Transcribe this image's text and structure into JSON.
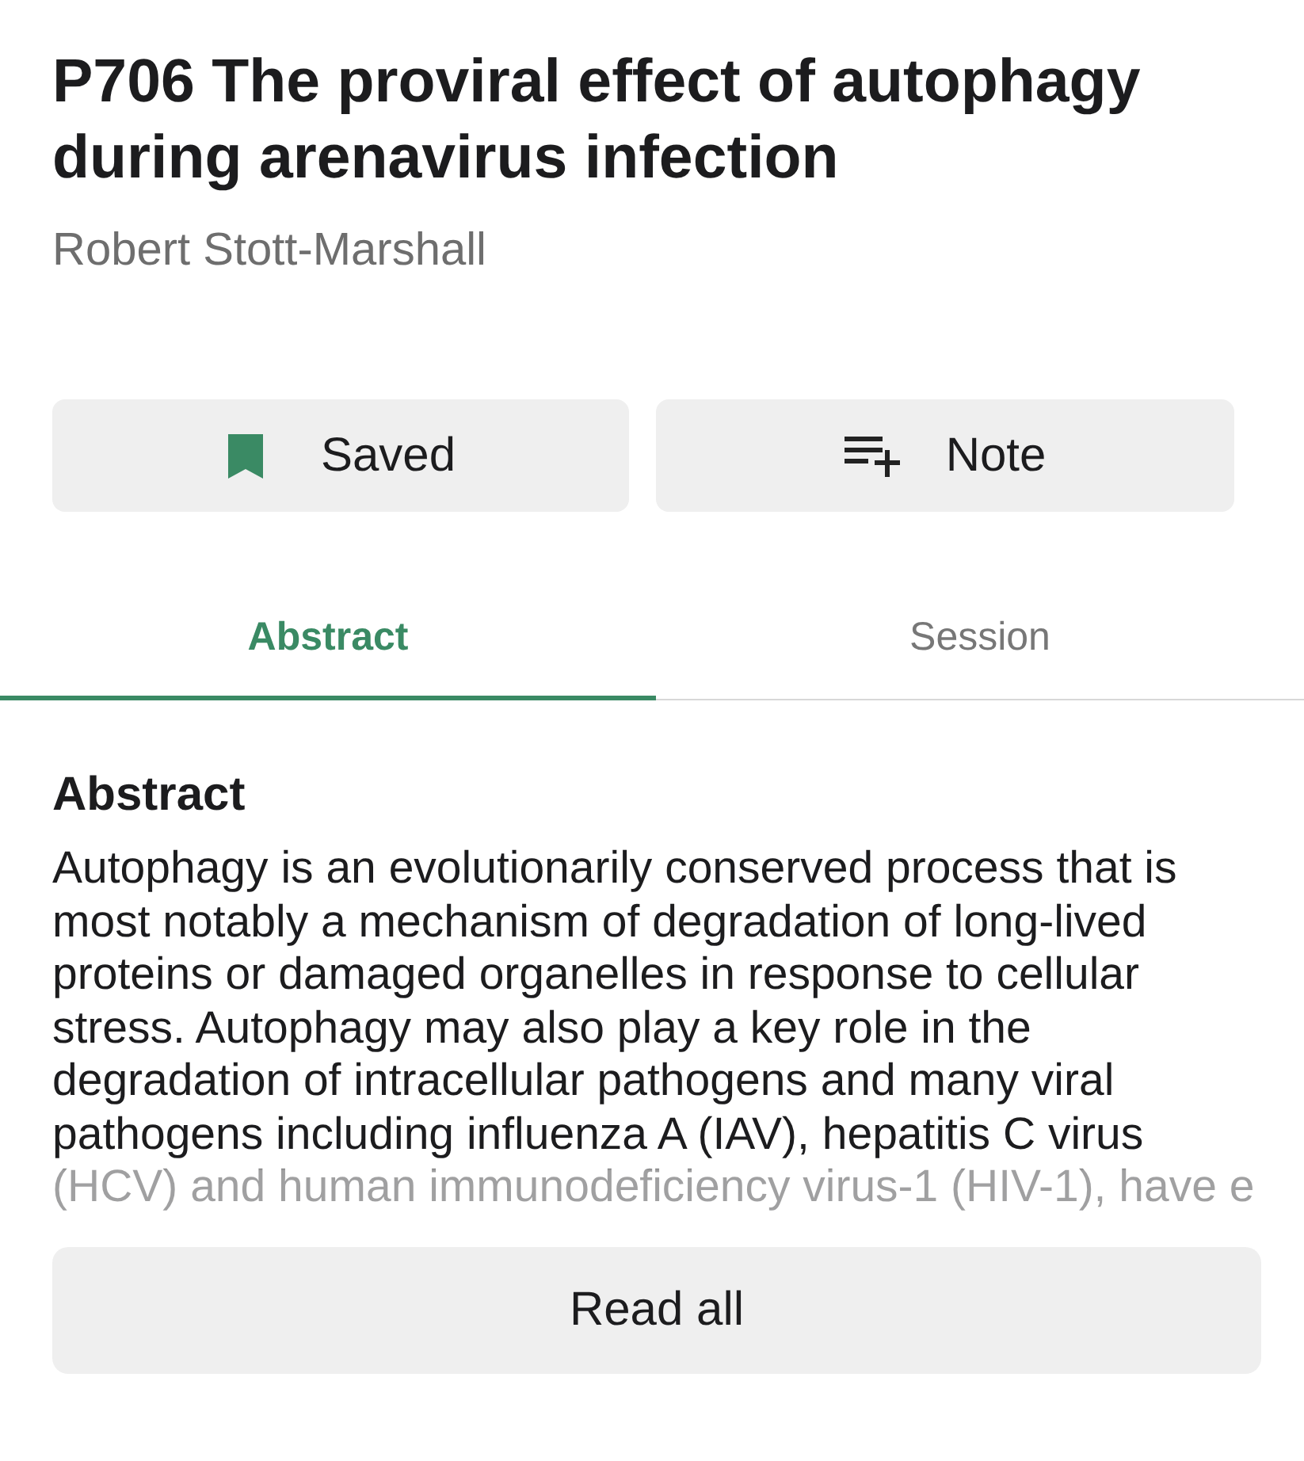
{
  "title": "P706 The proviral effect of autophagy during arenavirus infection",
  "author": "Robert Stott-Marshall",
  "save_button": {
    "label": "Saved",
    "saved": true
  },
  "note_button": {
    "label": "Note"
  },
  "tabs": [
    {
      "label": "Abstract",
      "selected": true
    },
    {
      "label": "Session",
      "selected": false
    }
  ],
  "abstract": {
    "heading": "Abstract",
    "text": "Autophagy is an evolutionarily conserved process that is most notably a mechanism of degradation of long-lived proteins or damaged organelles in response to cellular stress. Autophagy may also play a key role in the degradation of intracellular pathogens and many viral pathogens including influenza A (IAV), hepatitis C virus (HCV) and human immunodeficiency virus-1 (HIV-1), have e"
  },
  "read_all_button": {
    "label": "Read all"
  }
}
